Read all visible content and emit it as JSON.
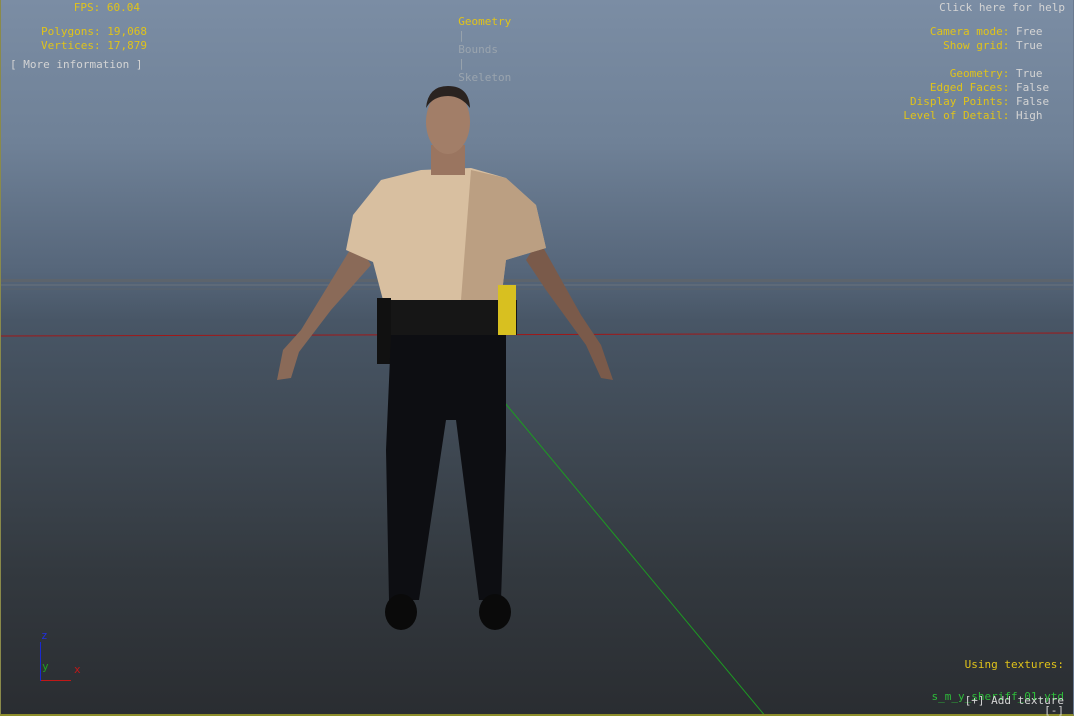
{
  "stats": {
    "fps_label": "FPS:",
    "fps": "60.04",
    "polygons_label": "Polygons:",
    "polygons": "19,068",
    "vertices_label": "Vertices:",
    "vertices": "17,879",
    "more_info": "[ More information ]"
  },
  "tabs": [
    {
      "label": "Geometry",
      "active": true
    },
    {
      "label": "Bounds",
      "active": false
    },
    {
      "label": "Skeleton",
      "active": false
    }
  ],
  "tab_separator": "|",
  "help": "Click here for help",
  "settings": [
    {
      "label": "Camera mode:",
      "value": "Free"
    },
    {
      "label": "Show grid:",
      "value": "True"
    },
    {
      "label": "Geometry:",
      "value": "True"
    },
    {
      "label": "Edged Faces:",
      "value": "False"
    },
    {
      "label": "Display Points:",
      "value": "False"
    },
    {
      "label": "Level of Detail:",
      "value": "High"
    }
  ],
  "textures": {
    "heading": "Using textures:",
    "file": "s_m_y_sheriff_01.ytd",
    "remove": "[-]",
    "add": "[+] Add texture"
  },
  "axes": {
    "z": "z",
    "y": "y",
    "x": "x"
  },
  "colors": {
    "label": "#e0c31a",
    "value": "#d4d4d4",
    "texture": "#2ebd3a"
  }
}
